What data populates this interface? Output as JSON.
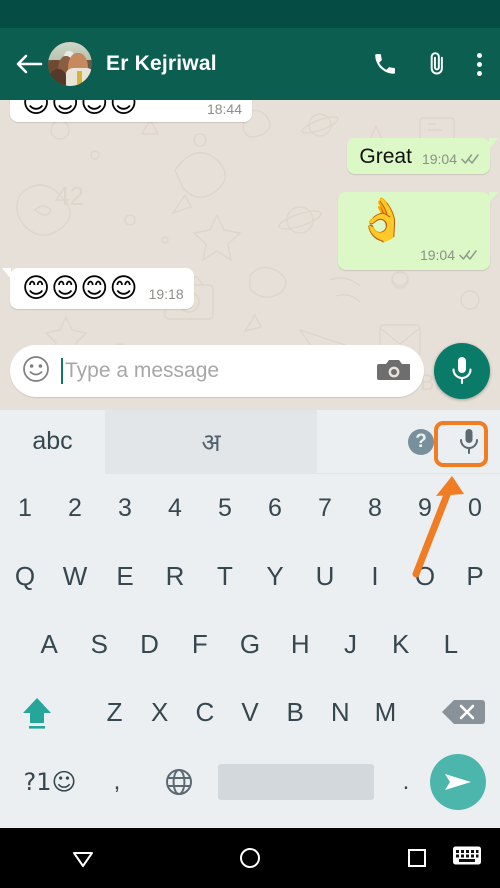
{
  "header": {
    "back_icon": "back-arrow-icon",
    "avatar": "contact-avatar",
    "contact_name": "Er Kejriwal",
    "call_icon": "phone-icon",
    "attach_icon": "paperclip-icon",
    "menu_icon": "overflow-menu-icon"
  },
  "chat": {
    "background_color": "#e7e0d8",
    "messages": [
      {
        "id": "m1",
        "direction": "in",
        "type": "emoji",
        "text": "😊😊😊😊",
        "time": "18:44",
        "status": ""
      },
      {
        "id": "m2",
        "direction": "out",
        "type": "text",
        "text": "Great",
        "time": "19:04",
        "status": "delivered"
      },
      {
        "id": "m3",
        "direction": "out",
        "type": "emoji",
        "text": "👌",
        "time": "19:04",
        "status": "delivered"
      },
      {
        "id": "m4",
        "direction": "in",
        "type": "emoji",
        "text": "😊😊😊😊",
        "time": "19:18",
        "status": ""
      }
    ],
    "bubble_in_color": "#ffffff",
    "bubble_out_color": "#dcf8c6",
    "tick_color": "#8d9a8d"
  },
  "composer": {
    "emoji_icon": "smiley-icon",
    "placeholder": "Type a message",
    "value": "",
    "camera_icon": "camera-icon",
    "mic_icon": "microphone-icon",
    "mic_button_color": "#0a7b68"
  },
  "keyboard": {
    "toolbar": {
      "lang_latin": "abc",
      "lang_indic": "अ",
      "help_label": "?",
      "help_icon": "help-icon",
      "voice_icon": "microphone-icon",
      "active_tab": "abc"
    },
    "row_numbers": [
      "1",
      "2",
      "3",
      "4",
      "5",
      "6",
      "7",
      "8",
      "9",
      "0"
    ],
    "row_top": [
      "Q",
      "W",
      "E",
      "R",
      "T",
      "Y",
      "U",
      "I",
      "O",
      "P"
    ],
    "row_home": [
      "A",
      "S",
      "D",
      "F",
      "G",
      "H",
      "J",
      "K",
      "L"
    ],
    "row_bottom": [
      "Z",
      "X",
      "C",
      "V",
      "B",
      "N",
      "M"
    ],
    "shift_icon": "shift-arrow-icon",
    "backspace_icon": "backspace-icon",
    "symbols_key": "?1☺",
    "comma_key": ",",
    "globe_icon": "globe-icon",
    "space_key": "",
    "period_key": ".",
    "send_icon": "send-icon",
    "shift_color": "#26a69a",
    "send_color": "#4db6ac",
    "background_color": "#eceff1"
  },
  "annotation": {
    "highlight_target": "keyboard-voice-input-button",
    "highlight_color": "#f07c24",
    "arrow_color": "#f07c24"
  },
  "navbar": {
    "back_icon": "nav-back-triangle-icon",
    "home_icon": "nav-home-circle-icon",
    "recents_icon": "nav-recents-square-icon",
    "switch_keyboard_icon": "nav-keyboard-icon"
  }
}
